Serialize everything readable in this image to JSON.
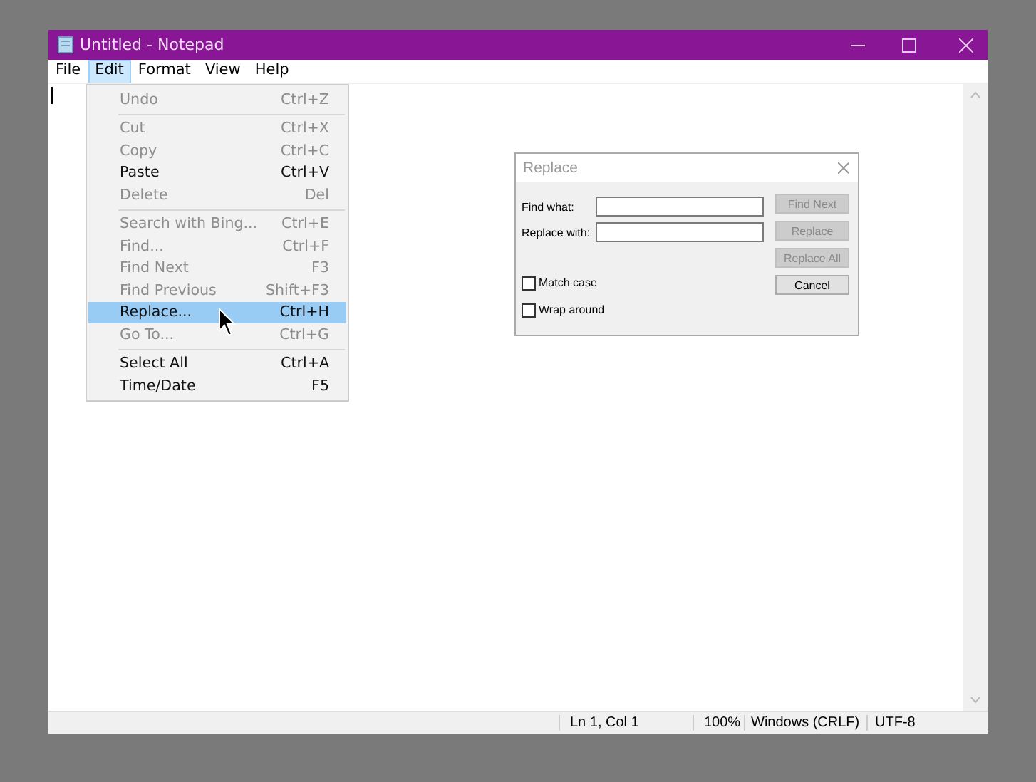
{
  "window": {
    "title": "Untitled - Notepad"
  },
  "menu_bar": [
    {
      "label": "File",
      "selected": false
    },
    {
      "label": "Edit",
      "selected": true
    },
    {
      "label": "Format",
      "selected": false
    },
    {
      "label": "View",
      "selected": false
    },
    {
      "label": "Help",
      "selected": false
    }
  ],
  "edit_menu": [
    {
      "kind": "item",
      "label": "Undo",
      "shortcut": "Ctrl+Z",
      "disabled": true,
      "selected": false
    },
    {
      "kind": "separator"
    },
    {
      "kind": "item",
      "label": "Cut",
      "shortcut": "Ctrl+X",
      "disabled": true,
      "selected": false
    },
    {
      "kind": "item",
      "label": "Copy",
      "shortcut": "Ctrl+C",
      "disabled": true,
      "selected": false
    },
    {
      "kind": "item",
      "label": "Paste",
      "shortcut": "Ctrl+V",
      "disabled": false,
      "selected": false
    },
    {
      "kind": "item",
      "label": "Delete",
      "shortcut": "Del",
      "disabled": true,
      "selected": false
    },
    {
      "kind": "separator"
    },
    {
      "kind": "item",
      "label": "Search with Bing...",
      "shortcut": "Ctrl+E",
      "disabled": true,
      "selected": false
    },
    {
      "kind": "item",
      "label": "Find...",
      "shortcut": "Ctrl+F",
      "disabled": true,
      "selected": false
    },
    {
      "kind": "item",
      "label": "Find Next",
      "shortcut": "F3",
      "disabled": true,
      "selected": false
    },
    {
      "kind": "item",
      "label": "Find Previous",
      "shortcut": "Shift+F3",
      "disabled": true,
      "selected": false
    },
    {
      "kind": "item",
      "label": "Replace...",
      "shortcut": "Ctrl+H",
      "disabled": false,
      "selected": true
    },
    {
      "kind": "item",
      "label": "Go To...",
      "shortcut": "Ctrl+G",
      "disabled": true,
      "selected": false
    },
    {
      "kind": "separator"
    },
    {
      "kind": "item",
      "label": "Select All",
      "shortcut": "Ctrl+A",
      "disabled": false,
      "selected": false
    },
    {
      "kind": "item",
      "label": "Time/Date",
      "shortcut": "F5",
      "disabled": false,
      "selected": false
    }
  ],
  "replace_dialog": {
    "title": "Replace",
    "fields": [
      {
        "label": "Find what:"
      },
      {
        "label": "Replace with:"
      }
    ],
    "buttons": [
      {
        "label": "Find Next",
        "disabled": true
      },
      {
        "label": "Replace",
        "disabled": true
      },
      {
        "label": "Replace All",
        "disabled": true
      },
      {
        "label": "Cancel",
        "disabled": false
      }
    ],
    "checkboxes": [
      {
        "label": "Match case",
        "checked": false
      },
      {
        "label": "Wrap around",
        "checked": false
      }
    ]
  },
  "status_bar": [
    "Ln 1, Col 1",
    "100%",
    "Windows (CRLF)",
    "UTF-8"
  ]
}
